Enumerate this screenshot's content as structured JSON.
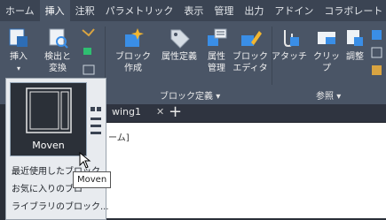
{
  "tabs": [
    "ホーム",
    "挿入",
    "注釈",
    "パラメトリック",
    "表示",
    "管理",
    "出力",
    "アドイン",
    "コラボレート"
  ],
  "active_tab_index": 1,
  "ribbon": {
    "insert_label": "挿入",
    "detect_label_line1": "検出と",
    "detect_label_line2": "変換",
    "block_create_line1": "ブロック",
    "block_create_line2": "作成",
    "attr_define": "属性定義",
    "attr_manage_line1": "属性",
    "attr_manage_line2": "管理",
    "block_editor_line1": "ブロック",
    "block_editor_line2": "エディタ",
    "block_define_panel": "ブロック定義",
    "attach": "アタッチ",
    "clip": "クリップ",
    "adjust": "調整",
    "reference_panel": "参照"
  },
  "document": {
    "tab_label": "wing1",
    "canvas_label": "ーム]"
  },
  "dropdown": {
    "gallery_caption": "Moven",
    "recent_blocks": "最近使用したブロック...",
    "favorite_blocks": "お気に入りのブロ",
    "library_blocks": "ライブラリのブロック..."
  },
  "tooltip": "Moven",
  "colors": {
    "tabbar": "#3b4453",
    "ribbon": "#4a5566",
    "dropdown_bg": "#e8ebef",
    "accent_blue": "#3a8ee6"
  }
}
